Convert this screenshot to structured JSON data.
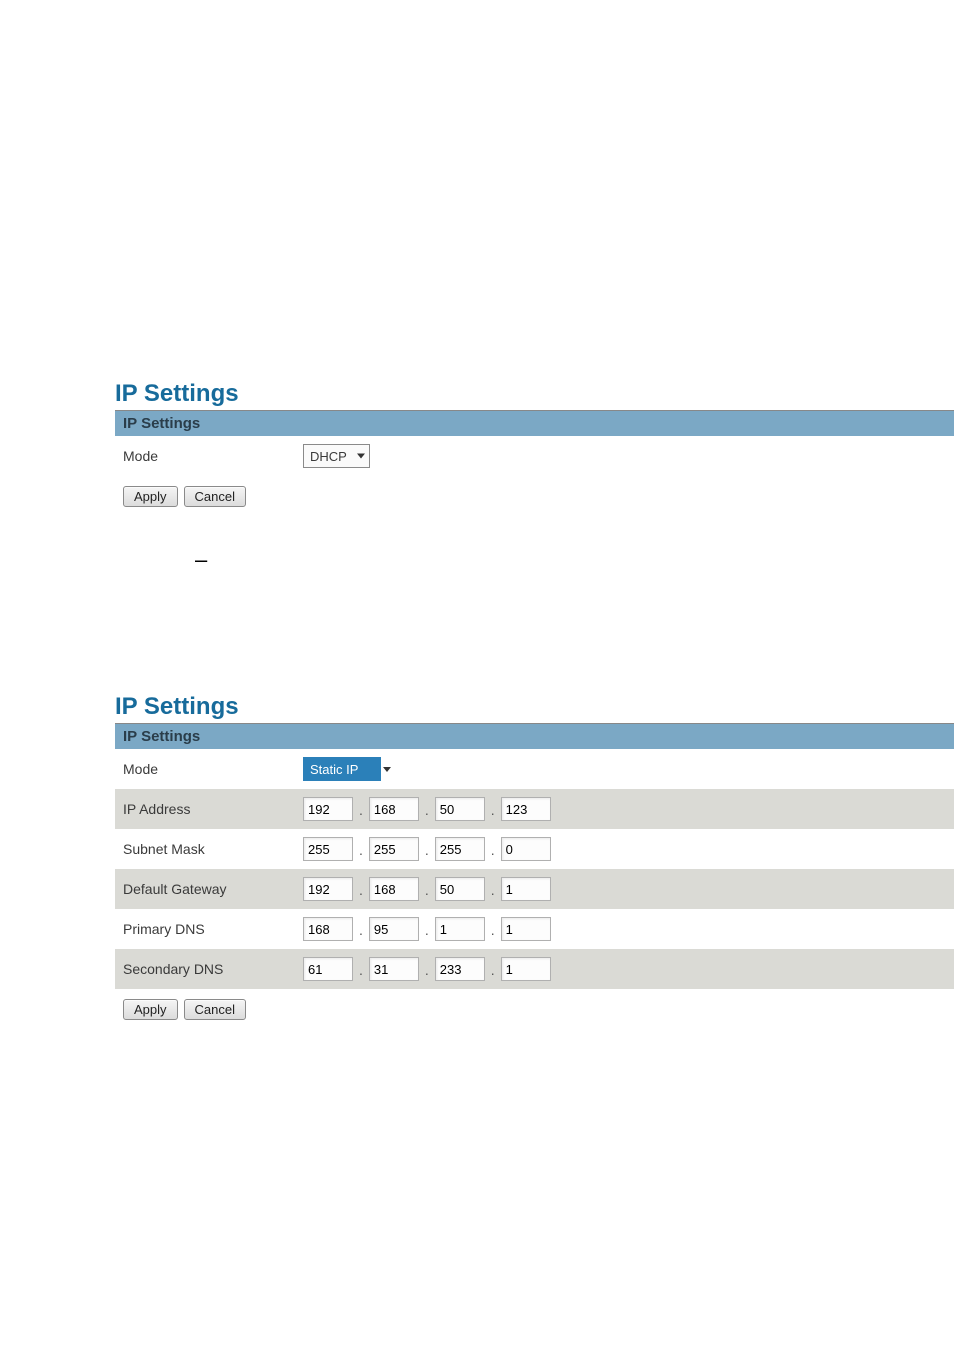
{
  "section1": {
    "title": "IP Settings",
    "header": "IP Settings",
    "mode_label": "Mode",
    "mode_value": "DHCP",
    "apply": "Apply",
    "cancel": "Cancel",
    "dash": "–"
  },
  "section2": {
    "title": "IP Settings",
    "header": "IP Settings",
    "mode_label": "Mode",
    "mode_value": "Static IP",
    "rows": {
      "ip_address": {
        "label": "IP Address",
        "o1": "192",
        "o2": "168",
        "o3": "50",
        "o4": "123"
      },
      "subnet_mask": {
        "label": "Subnet Mask",
        "o1": "255",
        "o2": "255",
        "o3": "255",
        "o4": "0"
      },
      "default_gateway": {
        "label": "Default Gateway",
        "o1": "192",
        "o2": "168",
        "o3": "50",
        "o4": "1"
      },
      "primary_dns": {
        "label": "Primary DNS",
        "o1": "168",
        "o2": "95",
        "o3": "1",
        "o4": "1"
      },
      "secondary_dns": {
        "label": "Secondary DNS",
        "o1": "61",
        "o2": "31",
        "o3": "233",
        "o4": "1"
      }
    },
    "apply": "Apply",
    "cancel": "Cancel"
  }
}
